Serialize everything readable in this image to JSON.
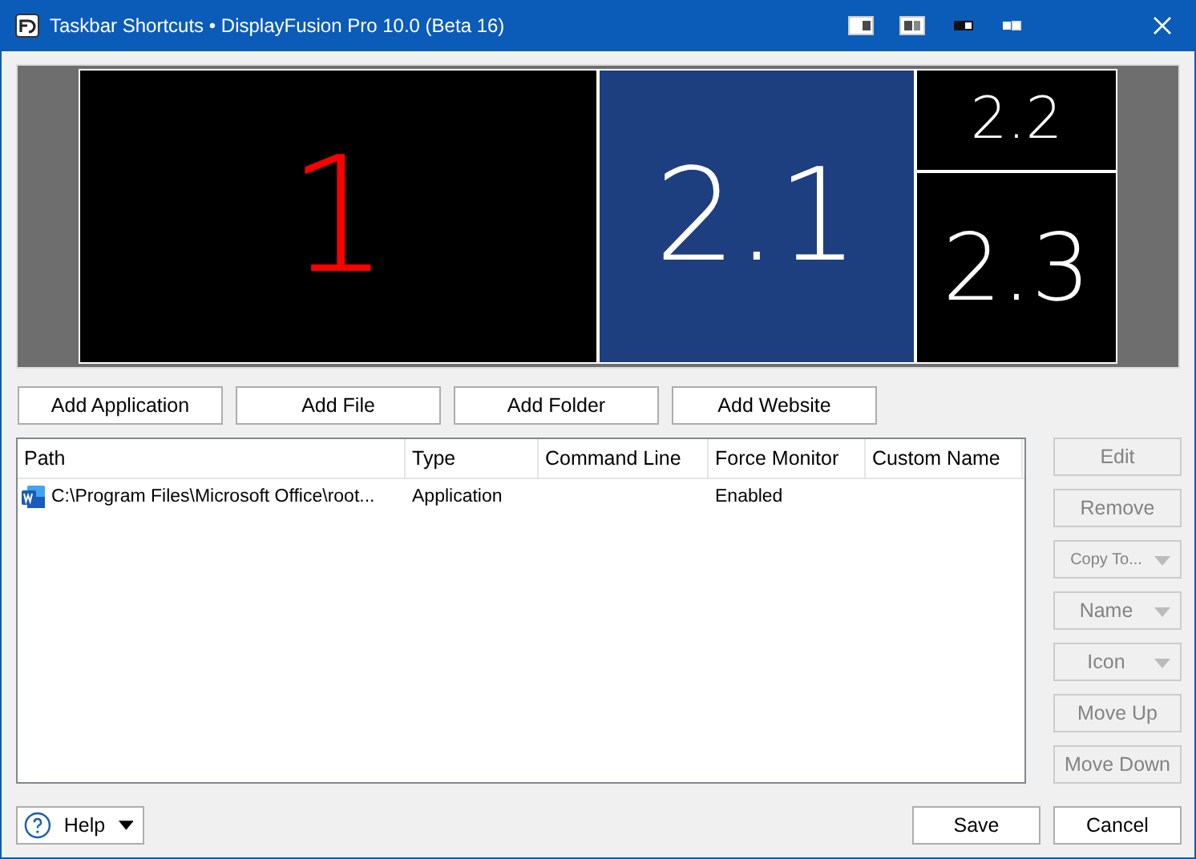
{
  "window": {
    "title": "Taskbar Shortcuts • DisplayFusion Pro 10.0 (Beta 16)"
  },
  "monitors": [
    {
      "label": "1",
      "selected": false,
      "color": "#ff0000"
    },
    {
      "label": "2.1",
      "selected": true,
      "color": "#ffffff"
    },
    {
      "label": "2.2",
      "selected": false,
      "color": "#ffffff"
    },
    {
      "label": "2.3",
      "selected": false,
      "color": "#ffffff"
    }
  ],
  "add_buttons": [
    "Add Application",
    "Add File",
    "Add Folder",
    "Add Website"
  ],
  "table": {
    "columns": [
      "Path",
      "Type",
      "Command Line",
      "Force Monitor",
      "Custom Name"
    ],
    "rows": [
      {
        "cells": [
          "C:\\Program Files\\Microsoft Office\\root...",
          "Application",
          "",
          "Enabled",
          ""
        ],
        "selected": false
      }
    ]
  },
  "side_buttons": [
    {
      "label": "Edit",
      "kind": "button",
      "disabled": true
    },
    {
      "label": "Remove",
      "kind": "button",
      "disabled": true
    },
    {
      "label": "Copy To...",
      "kind": "dropdown",
      "disabled": true
    },
    {
      "label": "Name",
      "kind": "dropdown",
      "disabled": true
    },
    {
      "label": "Icon",
      "kind": "dropdown",
      "disabled": true
    },
    {
      "label": "Move Up",
      "kind": "button",
      "disabled": true
    },
    {
      "label": "Move Down",
      "kind": "button",
      "disabled": true
    }
  ],
  "help_button": {
    "label": "Help"
  },
  "buttons": [
    "Save",
    "Cancel"
  ]
}
